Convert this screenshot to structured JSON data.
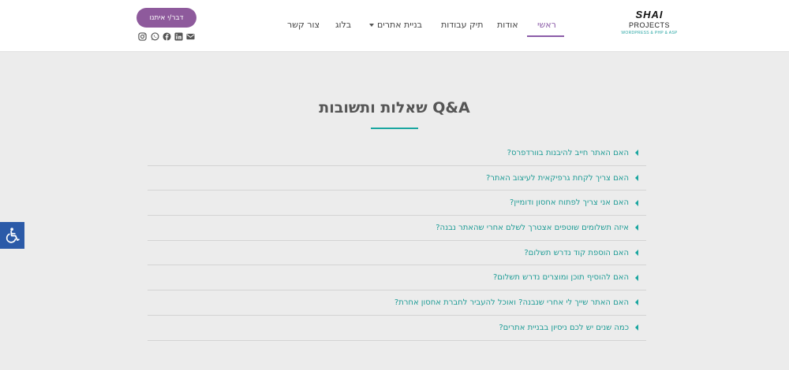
{
  "logo": {
    "line1": "SHAI",
    "line2": "PROJECTS",
    "line3": "WORDPRESS & PHP & ASP"
  },
  "nav": {
    "items": [
      {
        "label": "ראשי"
      },
      {
        "label": "אודות"
      },
      {
        "label": "תיק עבודות"
      },
      {
        "label": "בניית אתרים"
      },
      {
        "label": "בלוג"
      },
      {
        "label": "צור קשר"
      }
    ]
  },
  "cta": {
    "label": "דבר/י איתנו"
  },
  "social": [
    "email-icon",
    "linkedin-icon",
    "facebook-icon",
    "whatsapp-icon",
    "instagram-icon"
  ],
  "colors": {
    "accent_purple": "#8e5a9c",
    "accent_teal": "#1aa6a0",
    "a11y_blue": "#2b5aa8"
  },
  "faq": {
    "title": "שאלות ותשובות Q&A",
    "items": [
      {
        "question": "האם האתר חייב להיבנות בוורדפרס?"
      },
      {
        "question": "האם צריך לקחת גרפיקאית לעיצוב האתר?"
      },
      {
        "question": "האם אני צריך לפתוח אחסון ודומיין?"
      },
      {
        "question": "איזה תשלומים שוטפים אצטרך לשלם אחרי שהאתר נבנה?"
      },
      {
        "question": "האם הוספת קוד נדרש תשלום?"
      },
      {
        "question": "האם להוסיף תוכן ומוצרים נדרש תשלום?"
      },
      {
        "question": "האם האתר שייך לי אחרי שנבנה? ואוכל להעביר לחברת אחסון אחרת?"
      },
      {
        "question": "כמה שנים יש לכם ניסיון בבניית אתרים?"
      }
    ]
  }
}
